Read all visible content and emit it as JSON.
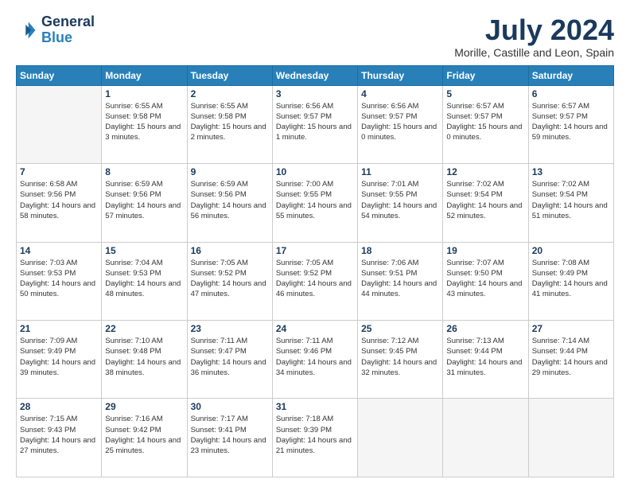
{
  "logo": {
    "line1": "General",
    "line2": "Blue"
  },
  "title": "July 2024",
  "subtitle": "Morille, Castille and Leon, Spain",
  "days_header": [
    "Sunday",
    "Monday",
    "Tuesday",
    "Wednesday",
    "Thursday",
    "Friday",
    "Saturday"
  ],
  "weeks": [
    [
      {
        "day": "",
        "sunrise": "",
        "sunset": "",
        "daylight": ""
      },
      {
        "day": "1",
        "sunrise": "Sunrise: 6:55 AM",
        "sunset": "Sunset: 9:58 PM",
        "daylight": "Daylight: 15 hours and 3 minutes."
      },
      {
        "day": "2",
        "sunrise": "Sunrise: 6:55 AM",
        "sunset": "Sunset: 9:58 PM",
        "daylight": "Daylight: 15 hours and 2 minutes."
      },
      {
        "day": "3",
        "sunrise": "Sunrise: 6:56 AM",
        "sunset": "Sunset: 9:57 PM",
        "daylight": "Daylight: 15 hours and 1 minute."
      },
      {
        "day": "4",
        "sunrise": "Sunrise: 6:56 AM",
        "sunset": "Sunset: 9:57 PM",
        "daylight": "Daylight: 15 hours and 0 minutes."
      },
      {
        "day": "5",
        "sunrise": "Sunrise: 6:57 AM",
        "sunset": "Sunset: 9:57 PM",
        "daylight": "Daylight: 15 hours and 0 minutes."
      },
      {
        "day": "6",
        "sunrise": "Sunrise: 6:57 AM",
        "sunset": "Sunset: 9:57 PM",
        "daylight": "Daylight: 14 hours and 59 minutes."
      }
    ],
    [
      {
        "day": "7",
        "sunrise": "Sunrise: 6:58 AM",
        "sunset": "Sunset: 9:56 PM",
        "daylight": "Daylight: 14 hours and 58 minutes."
      },
      {
        "day": "8",
        "sunrise": "Sunrise: 6:59 AM",
        "sunset": "Sunset: 9:56 PM",
        "daylight": "Daylight: 14 hours and 57 minutes."
      },
      {
        "day": "9",
        "sunrise": "Sunrise: 6:59 AM",
        "sunset": "Sunset: 9:56 PM",
        "daylight": "Daylight: 14 hours and 56 minutes."
      },
      {
        "day": "10",
        "sunrise": "Sunrise: 7:00 AM",
        "sunset": "Sunset: 9:55 PM",
        "daylight": "Daylight: 14 hours and 55 minutes."
      },
      {
        "day": "11",
        "sunrise": "Sunrise: 7:01 AM",
        "sunset": "Sunset: 9:55 PM",
        "daylight": "Daylight: 14 hours and 54 minutes."
      },
      {
        "day": "12",
        "sunrise": "Sunrise: 7:02 AM",
        "sunset": "Sunset: 9:54 PM",
        "daylight": "Daylight: 14 hours and 52 minutes."
      },
      {
        "day": "13",
        "sunrise": "Sunrise: 7:02 AM",
        "sunset": "Sunset: 9:54 PM",
        "daylight": "Daylight: 14 hours and 51 minutes."
      }
    ],
    [
      {
        "day": "14",
        "sunrise": "Sunrise: 7:03 AM",
        "sunset": "Sunset: 9:53 PM",
        "daylight": "Daylight: 14 hours and 50 minutes."
      },
      {
        "day": "15",
        "sunrise": "Sunrise: 7:04 AM",
        "sunset": "Sunset: 9:53 PM",
        "daylight": "Daylight: 14 hours and 48 minutes."
      },
      {
        "day": "16",
        "sunrise": "Sunrise: 7:05 AM",
        "sunset": "Sunset: 9:52 PM",
        "daylight": "Daylight: 14 hours and 47 minutes."
      },
      {
        "day": "17",
        "sunrise": "Sunrise: 7:05 AM",
        "sunset": "Sunset: 9:52 PM",
        "daylight": "Daylight: 14 hours and 46 minutes."
      },
      {
        "day": "18",
        "sunrise": "Sunrise: 7:06 AM",
        "sunset": "Sunset: 9:51 PM",
        "daylight": "Daylight: 14 hours and 44 minutes."
      },
      {
        "day": "19",
        "sunrise": "Sunrise: 7:07 AM",
        "sunset": "Sunset: 9:50 PM",
        "daylight": "Daylight: 14 hours and 43 minutes."
      },
      {
        "day": "20",
        "sunrise": "Sunrise: 7:08 AM",
        "sunset": "Sunset: 9:49 PM",
        "daylight": "Daylight: 14 hours and 41 minutes."
      }
    ],
    [
      {
        "day": "21",
        "sunrise": "Sunrise: 7:09 AM",
        "sunset": "Sunset: 9:49 PM",
        "daylight": "Daylight: 14 hours and 39 minutes."
      },
      {
        "day": "22",
        "sunrise": "Sunrise: 7:10 AM",
        "sunset": "Sunset: 9:48 PM",
        "daylight": "Daylight: 14 hours and 38 minutes."
      },
      {
        "day": "23",
        "sunrise": "Sunrise: 7:11 AM",
        "sunset": "Sunset: 9:47 PM",
        "daylight": "Daylight: 14 hours and 36 minutes."
      },
      {
        "day": "24",
        "sunrise": "Sunrise: 7:11 AM",
        "sunset": "Sunset: 9:46 PM",
        "daylight": "Daylight: 14 hours and 34 minutes."
      },
      {
        "day": "25",
        "sunrise": "Sunrise: 7:12 AM",
        "sunset": "Sunset: 9:45 PM",
        "daylight": "Daylight: 14 hours and 32 minutes."
      },
      {
        "day": "26",
        "sunrise": "Sunrise: 7:13 AM",
        "sunset": "Sunset: 9:44 PM",
        "daylight": "Daylight: 14 hours and 31 minutes."
      },
      {
        "day": "27",
        "sunrise": "Sunrise: 7:14 AM",
        "sunset": "Sunset: 9:44 PM",
        "daylight": "Daylight: 14 hours and 29 minutes."
      }
    ],
    [
      {
        "day": "28",
        "sunrise": "Sunrise: 7:15 AM",
        "sunset": "Sunset: 9:43 PM",
        "daylight": "Daylight: 14 hours and 27 minutes."
      },
      {
        "day": "29",
        "sunrise": "Sunrise: 7:16 AM",
        "sunset": "Sunset: 9:42 PM",
        "daylight": "Daylight: 14 hours and 25 minutes."
      },
      {
        "day": "30",
        "sunrise": "Sunrise: 7:17 AM",
        "sunset": "Sunset: 9:41 PM",
        "daylight": "Daylight: 14 hours and 23 minutes."
      },
      {
        "day": "31",
        "sunrise": "Sunrise: 7:18 AM",
        "sunset": "Sunset: 9:39 PM",
        "daylight": "Daylight: 14 hours and 21 minutes."
      },
      {
        "day": "",
        "sunrise": "",
        "sunset": "",
        "daylight": ""
      },
      {
        "day": "",
        "sunrise": "",
        "sunset": "",
        "daylight": ""
      },
      {
        "day": "",
        "sunrise": "",
        "sunset": "",
        "daylight": ""
      }
    ]
  ]
}
